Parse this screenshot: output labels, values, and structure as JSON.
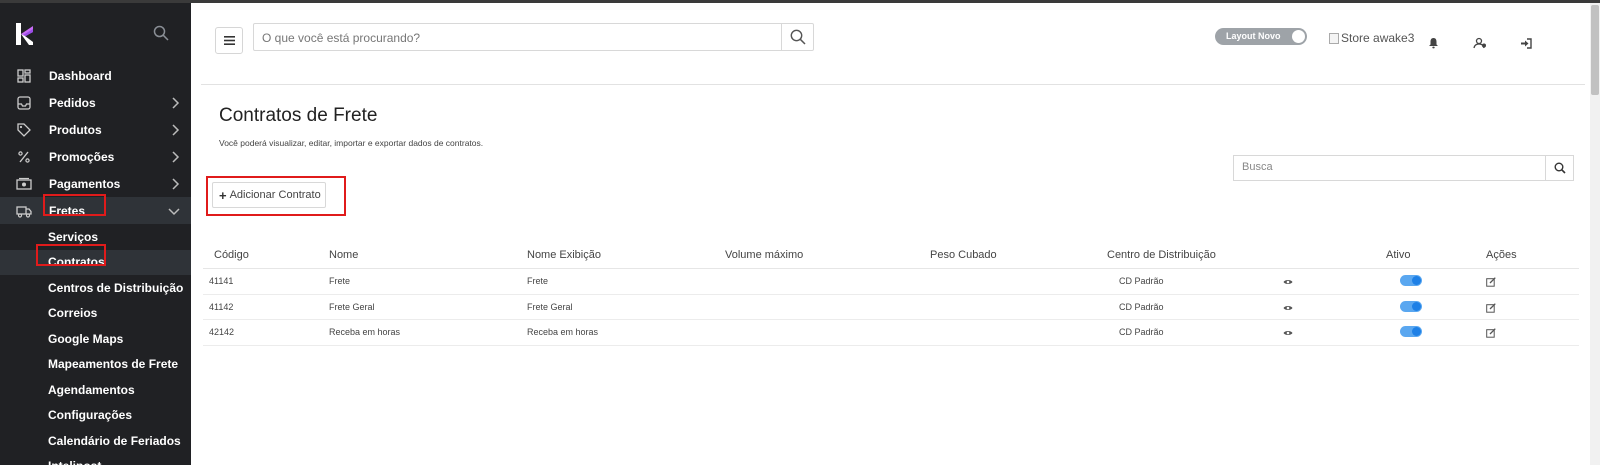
{
  "sidebar": {
    "items": [
      {
        "label": "Dashboard",
        "icon": "dashboard-icon",
        "has_chevron": false
      },
      {
        "label": "Pedidos",
        "icon": "inbox-icon",
        "has_chevron": true
      },
      {
        "label": "Produtos",
        "icon": "tag-icon",
        "has_chevron": true
      },
      {
        "label": "Promoções",
        "icon": "percent-icon",
        "has_chevron": true
      },
      {
        "label": "Pagamentos",
        "icon": "money-icon",
        "has_chevron": true
      },
      {
        "label": "Fretes",
        "icon": "truck-icon",
        "has_chevron": true,
        "expanded": true
      }
    ],
    "subitems": [
      "Serviços",
      "Contratos",
      "Centros de Distribuição",
      "Correios",
      "Google Maps",
      "Mapeamentos de Frete",
      "Agendamentos",
      "Configurações",
      "Calendário de Feriados",
      "Intelipost"
    ],
    "active_subitem": "Contratos"
  },
  "header": {
    "search_placeholder": "O que você está procurando?",
    "layout_toggle_label": "Layout Novo",
    "store_alt": "Store awake3"
  },
  "page": {
    "title": "Contratos de Frete",
    "description": "Você poderá visualizar, editar, importar e exportar dados de contratos.",
    "busca_placeholder": "Busca",
    "add_button_label": "Adicionar Contrato"
  },
  "table": {
    "headers": [
      "Código",
      "Nome",
      "Nome Exibição",
      "Volume máximo",
      "Peso Cubado",
      "Centro de Distribuição",
      "Ativo",
      "Ações"
    ],
    "rows": [
      {
        "codigo": "41141",
        "nome": "Frete",
        "nome_exibicao": "Frete",
        "volume": "",
        "peso": "",
        "centro": "CD Padrão",
        "ativo": true
      },
      {
        "codigo": "41142",
        "nome": "Frete Geral",
        "nome_exibicao": "Frete Geral",
        "volume": "",
        "peso": "",
        "centro": "CD Padrão",
        "ativo": true
      },
      {
        "codigo": "42142",
        "nome": "Receba em horas",
        "nome_exibicao": "Receba em horas",
        "volume": "",
        "peso": "",
        "centro": "CD Padrão",
        "ativo": true
      }
    ]
  },
  "colors": {
    "sidebar_bg": "#202124",
    "active_bg": "#2f3338",
    "highlight_red": "#e01b1b",
    "toggle_blue": "#1e80e6"
  }
}
